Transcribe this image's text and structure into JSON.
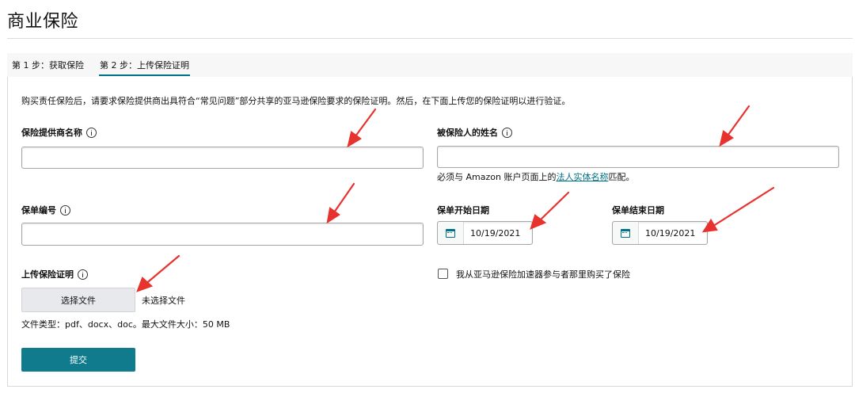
{
  "page_title": "商业保险",
  "tabs": [
    {
      "label": "第 1 步：获取保险"
    },
    {
      "label": "第 2 步：上传保险证明"
    }
  ],
  "intro_text": "购买责任保险后，请要求保险提供商出具符合“常见问题”部分共享的亚马逊保险要求的保险证明。然后，在下面上传您的保险证明以进行验证。",
  "fields": {
    "provider_name": {
      "label": "保险提供商名称",
      "value": ""
    },
    "insured_name": {
      "label": "被保险人的姓名",
      "value": ""
    },
    "insured_hint_prefix": "必须与 Amazon 账户页面上的",
    "insured_hint_link": "法人实体名称",
    "insured_hint_suffix": "匹配。",
    "policy_number": {
      "label": "保单编号",
      "value": ""
    },
    "start_date": {
      "label": "保单开始日期",
      "value": "10/19/2021"
    },
    "end_date": {
      "label": "保单结束日期",
      "value": "10/19/2021"
    }
  },
  "upload": {
    "label": "上传保险证明",
    "button": "选择文件",
    "status": "未选择文件",
    "file_types": "文件类型：pdf、docx、doc。最大文件大小：50 MB"
  },
  "checkbox": {
    "label": "我从亚马逊保险加速器参与者那里购买了保险",
    "checked": false
  },
  "submit_label": "提交",
  "icons": {
    "info": "info-icon",
    "calendar": "calendar-icon"
  },
  "colors": {
    "accent": "#007185",
    "submit_bg": "#0f7b8c",
    "annotation_arrow": "#e8322e"
  }
}
